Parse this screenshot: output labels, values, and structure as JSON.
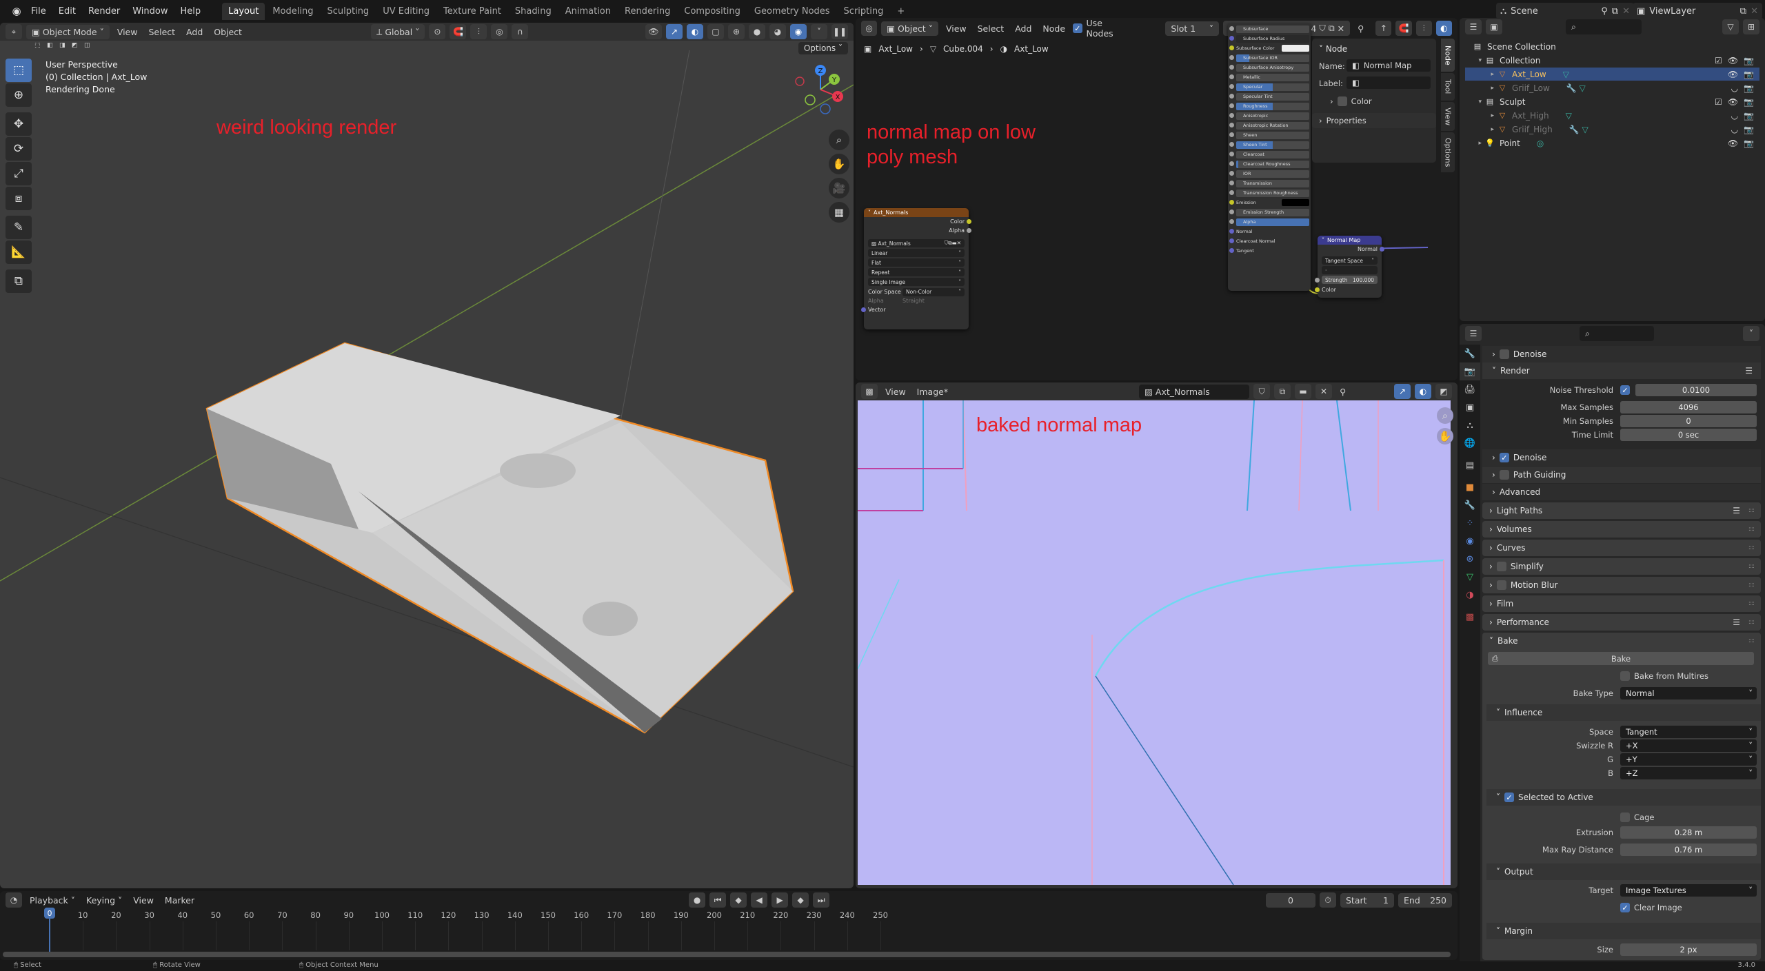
{
  "topbar": {
    "menus": [
      "File",
      "Edit",
      "Render",
      "Window",
      "Help"
    ],
    "workspaces": [
      "Layout",
      "Modeling",
      "Sculpting",
      "UV Editing",
      "Texture Paint",
      "Shading",
      "Animation",
      "Rendering",
      "Compositing",
      "Geometry Nodes",
      "Scripting"
    ],
    "active_workspace": "Layout",
    "add_tab": "+",
    "scene": "Scene",
    "view_layer": "ViewLayer"
  },
  "viewport": {
    "mode": "Object Mode",
    "menus": [
      "View",
      "Select",
      "Add",
      "Object"
    ],
    "transform_orientation": "Global",
    "options_label": "Options",
    "info": [
      "User Perspective",
      "(0) Collection | Axt_Low",
      "Rendering Done"
    ],
    "annotation": "weird looking render",
    "gizmo": {
      "x": "X",
      "y": "Y",
      "z": "Z"
    },
    "colors": {
      "selection_outline": "#f08a25",
      "x_axis": "#e8384f",
      "y_axis": "#8cc63f",
      "z_axis": "#3a87f5"
    }
  },
  "node_editor": {
    "type": "Object",
    "menus": [
      "View",
      "Select",
      "Add",
      "Node"
    ],
    "use_nodes_label": "Use Nodes",
    "use_nodes": true,
    "slot": "Slot 1",
    "material": "Axt_Low",
    "users": "4",
    "breadcrumb": [
      "Axt_Low",
      "Cube.004",
      "Axt_Low"
    ],
    "annotation": "normal map on low poly mesh",
    "image_node": {
      "title": "Axt_Normals",
      "outputs": [
        "Color",
        "Alpha"
      ],
      "image": "Axt_Normals",
      "interpolation": "Linear",
      "projection": "Flat",
      "extension": "Repeat",
      "source": "Single Image",
      "color_space_label": "Color Space",
      "color_space": "Non-Color",
      "alpha_label": "Alpha",
      "alpha": "Straight",
      "input": "Vector"
    },
    "normal_map_node": {
      "title": "Normal Map",
      "output": "Normal",
      "space": "Tangent Space",
      "uv": "",
      "strength_label": "Strength",
      "strength": "100.000",
      "input": "Color"
    },
    "bsdf_inputs": [
      {
        "label": "Subsurface",
        "fill": 0
      },
      {
        "label": "Subsurface Radius",
        "fill": 0,
        "dark": true
      },
      {
        "label": "Subsurface Color",
        "color": "#eeeeee"
      },
      {
        "label": "Subsurface IOR",
        "fill": 0.18
      },
      {
        "label": "Subsurface Anisotropy",
        "fill": 0
      },
      {
        "label": "Metallic",
        "fill": 0
      },
      {
        "label": "Specular",
        "fill": 0.5
      },
      {
        "label": "Specular Tint",
        "fill": 0
      },
      {
        "label": "Roughness",
        "fill": 0.5
      },
      {
        "label": "Anisotropic",
        "fill": 0
      },
      {
        "label": "Anisotropic Rotation",
        "fill": 0
      },
      {
        "label": "Sheen",
        "fill": 0
      },
      {
        "label": "Sheen Tint",
        "fill": 0.5
      },
      {
        "label": "Clearcoat",
        "fill": 0
      },
      {
        "label": "Clearcoat Roughness",
        "fill": 0.03
      },
      {
        "label": "IOR",
        "fill": 0
      },
      {
        "label": "Transmission",
        "fill": 0
      },
      {
        "label": "Transmission Roughness",
        "fill": 0
      },
      {
        "label": "Emission",
        "color": "#000000"
      },
      {
        "label": "Emission Strength",
        "fill": 0
      },
      {
        "label": "Alpha",
        "fill": 1.0
      },
      {
        "label": "Normal",
        "socket_only": true
      },
      {
        "label": "Clearcoat Normal",
        "socket_only": true
      },
      {
        "label": "Tangent",
        "socket_only": true
      }
    ],
    "sidebar": {
      "section": "Node",
      "name_label": "Name:",
      "name": "Normal Map",
      "label_label": "Label:",
      "label": "",
      "color_label": "Color",
      "properties_label": "Properties",
      "tabs": [
        "Node",
        "Tool",
        "View",
        "Options"
      ]
    }
  },
  "image_editor": {
    "menus": [
      "View",
      "Image*"
    ],
    "image": "Axt_Normals",
    "annotation": "baked normal map",
    "base_color": "#bbb7f5"
  },
  "outliner": {
    "items": [
      {
        "name": "Scene Collection",
        "depth": 0,
        "type": "scene-collection"
      },
      {
        "name": "Collection",
        "depth": 1,
        "type": "collection",
        "expanded": true,
        "checked": true
      },
      {
        "name": "Axt_Low",
        "depth": 2,
        "type": "mesh",
        "selected": true,
        "data": "mesh"
      },
      {
        "name": "Griif_Low",
        "depth": 2,
        "type": "mesh",
        "hidden": true,
        "data": "modifier+mesh"
      },
      {
        "name": "Sculpt",
        "depth": 1,
        "type": "collection",
        "expanded": true,
        "checked": true
      },
      {
        "name": "Axt_High",
        "depth": 2,
        "type": "mesh",
        "hidden": true,
        "data": "mesh"
      },
      {
        "name": "Griif_High",
        "depth": 2,
        "type": "mesh",
        "hidden": true,
        "data": "modifier+mesh"
      },
      {
        "name": "Point",
        "depth": 1,
        "type": "light",
        "data": "light"
      }
    ]
  },
  "properties": {
    "denoise_top": {
      "label": "Denoise",
      "checked": false
    },
    "render_section": "Render",
    "noise_threshold": {
      "label": "Noise Threshold",
      "checked": true,
      "value": "0.0100"
    },
    "max_samples": {
      "label": "Max Samples",
      "value": "4096"
    },
    "min_samples": {
      "label": "Min Samples",
      "value": "0"
    },
    "time_limit": {
      "label": "Time Limit",
      "value": "0 sec"
    },
    "denoise": {
      "label": "Denoise",
      "checked": true
    },
    "path_guiding": {
      "label": "Path Guiding",
      "checked": false
    },
    "advanced": "Advanced",
    "sections": [
      "Light Paths",
      "Volumes",
      "Curves",
      "Simplify",
      "Motion Blur",
      "Film",
      "Performance"
    ],
    "bake": {
      "section": "Bake",
      "button": "Bake",
      "bake_from_multires": {
        "label": "Bake from Multires",
        "checked": false
      },
      "bake_type_label": "Bake Type",
      "bake_type": "Normal",
      "influence": "Influence",
      "space_label": "Space",
      "space": "Tangent",
      "swizzle_r_label": "Swizzle R",
      "swizzle_r": "+X",
      "swizzle_g_label": "G",
      "swizzle_g": "+Y",
      "swizzle_b_label": "B",
      "swizzle_b": "+Z",
      "selected_to_active": {
        "label": "Selected to Active",
        "checked": true
      },
      "cage": {
        "label": "Cage",
        "checked": false
      },
      "extrusion_label": "Extrusion",
      "extrusion": "0.28 m",
      "max_ray_label": "Max Ray Distance",
      "max_ray": "0.76 m",
      "output": "Output",
      "target_label": "Target",
      "target": "Image Textures",
      "clear_image": {
        "label": "Clear Image",
        "checked": true
      },
      "margin": "Margin",
      "size_label": "Size",
      "size": "2 px"
    },
    "version": "3.4.0"
  },
  "timeline": {
    "menus": [
      "Playback",
      "Keying",
      "View",
      "Marker"
    ],
    "current_frame": "0",
    "start_label": "Start",
    "start": "1",
    "end_label": "End",
    "end": "250",
    "ticks": [
      0,
      10,
      20,
      30,
      40,
      50,
      60,
      70,
      80,
      90,
      100,
      110,
      120,
      130,
      140,
      150,
      160,
      170,
      180,
      190,
      200,
      210,
      220,
      230,
      240,
      250
    ]
  },
  "statusbar": {
    "hints": [
      "Select",
      "Rotate View",
      "Object Context Menu"
    ]
  }
}
